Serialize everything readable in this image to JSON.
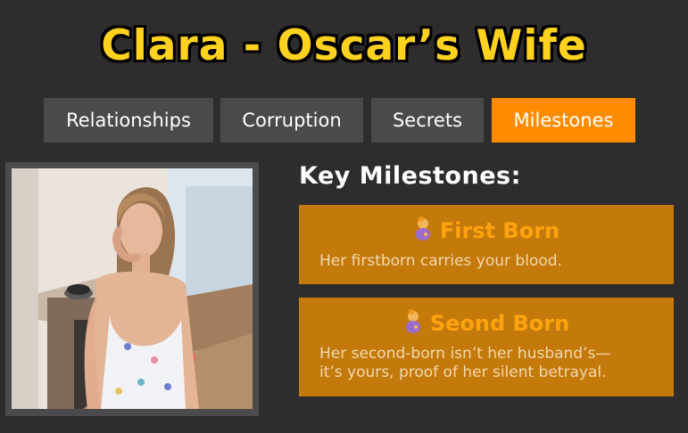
{
  "title": "Clara - Oscar’s Wife",
  "tabs": [
    {
      "label": "Relationships",
      "active": false
    },
    {
      "label": "Corruption",
      "active": false
    },
    {
      "label": "Secrets",
      "active": false
    },
    {
      "label": "Milestones",
      "active": true
    }
  ],
  "portrait": {
    "icon": "character-portrait-clara"
  },
  "milestones": {
    "heading": "Key Milestones:",
    "items": [
      {
        "icon": "baby-icon",
        "title": "First Born",
        "text_lines": [
          "Her firstborn carries your blood."
        ]
      },
      {
        "icon": "baby-icon",
        "title": "Seond Born",
        "text_lines": [
          "Her second-born isn’t her husband’s—",
          "it’s yours, proof of her silent betrayal."
        ]
      }
    ]
  },
  "colors": {
    "background": "#2e2c2d",
    "title": "#ffd21f",
    "tab": "#4a4a4d",
    "tab_active": "#ff8c00",
    "card": "#c47a0a",
    "card_title": "#ffa20f",
    "card_text": "#f2d7b0"
  }
}
